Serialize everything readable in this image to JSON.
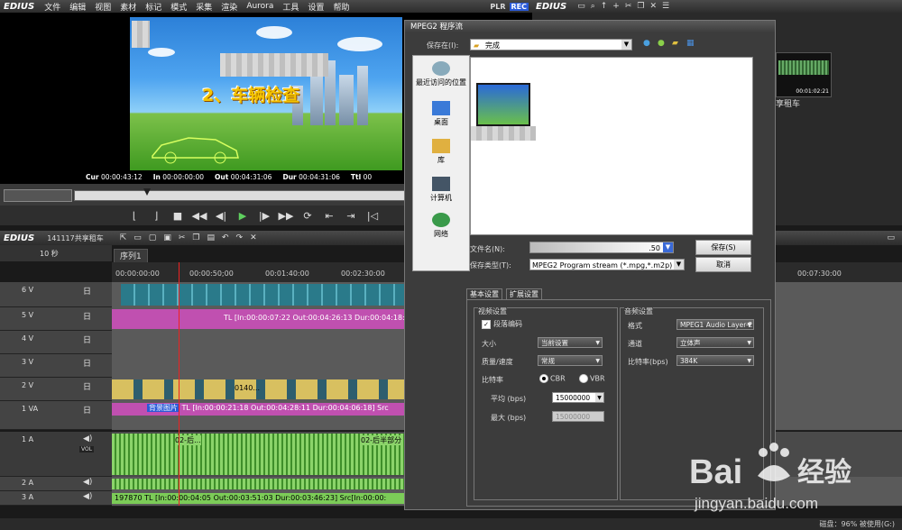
{
  "app": {
    "logo": "EDIUS",
    "menu": [
      "文件",
      "编辑",
      "视图",
      "素材",
      "标记",
      "模式",
      "采集",
      "渲染",
      "Aurora",
      "工具",
      "设置",
      "帮助"
    ],
    "mode_plr": "PLR",
    "mode_rec": "REC"
  },
  "preview": {
    "video_title": "2、车辆检查",
    "timecodes": [
      {
        "label": "Cur",
        "value": "00:00:43:12"
      },
      {
        "label": "In",
        "value": "00:00:00:00"
      },
      {
        "label": "Out",
        "value": "00:04:31:06"
      },
      {
        "label": "Dur",
        "value": "00:04:31:06"
      },
      {
        "label": "Ttl",
        "value": "00"
      }
    ]
  },
  "bin": {
    "logo": "EDIUS",
    "clip_name": "享租车",
    "clip_tc": "00:01:02:21"
  },
  "timeline": {
    "logo": "EDIUS",
    "project": "141117共享租车",
    "sequence_tab": "序列1",
    "zoom": "10 秒",
    "ruler": [
      "00:00:00:00",
      "00:00:50;00",
      "00:01:40:00",
      "00:02:30:00",
      "00:07:30:00"
    ],
    "tracks": [
      {
        "label": "6 V"
      },
      {
        "label": "5 V"
      },
      {
        "label": "4 V"
      },
      {
        "label": "3 V"
      },
      {
        "label": "2 V"
      },
      {
        "label": "1 VA"
      },
      {
        "label": "1 A",
        "vol": "VOL"
      },
      {
        "label": "2 A"
      },
      {
        "label": "3 A"
      }
    ],
    "clip_5v": "TL [In:00:00:07:22 Out:00:04:26:13 Dur:00:04:18:",
    "clip_2v": "0140...",
    "clip_1va_name": "背景图片",
    "clip_1va": "TL [In:00:00:21:18 Out:00:04:28:11 Dur:00:04:06:18]  Src",
    "clip_a1_a": "02-后...",
    "clip_a1_b": "02-后半部分",
    "clip_3a": "197870  TL [In:00:00:04:05 Out:00:03:51:03 Dur:00:03:46:23]  Src[In:00:00:",
    "status": "磁盘：96% 被使用(G:)"
  },
  "dialog": {
    "title": "MPEG2 程序流",
    "save_in_label": "保存在(I):",
    "save_in_value": "完成",
    "places": [
      "最近访问的位置",
      "桌面",
      "库",
      "计算机",
      "网络"
    ],
    "filename_label": "文件名(N):",
    "filename_value": ".50",
    "filetype_label": "保存类型(T):",
    "filetype_value": "MPEG2 Program stream (*.mpg,*.m2p)",
    "save_button": "保存(S)",
    "cancel_button": "取消",
    "tabs": [
      "基本设置",
      "扩展设置"
    ],
    "video_group": "视频设置",
    "field_encoding": "段落编码",
    "size_label": "大小",
    "size_value": "当前设置",
    "quality_label": "质量/速度",
    "quality_value": "常规",
    "bitrate_label": "比特率",
    "cbr": "CBR",
    "vbr": "VBR",
    "avg_label": "平均 (bps)",
    "avg_value": "15000000",
    "max_label": "最大 (bps)",
    "max_value": "15000000",
    "audio_group": "音频设置",
    "format_label": "格式",
    "format_value": "MPEG1 Audio Layer-2",
    "channel_label": "通道",
    "channel_value": "立体声",
    "abitrate_label": "比特率(bps)",
    "abitrate_value": "384K"
  },
  "watermark": {
    "brand": "Bai",
    "brand2": "经验",
    "url": "jingyan.baidu.com"
  },
  "colors": {
    "accent_rec": "#2a5ad8",
    "play_green": "#5fd05f",
    "clip_pink": "#c050b0",
    "clip_yellow": "#d8c060",
    "audio_green": "#8bd46a",
    "playhead": "#ee2222"
  }
}
